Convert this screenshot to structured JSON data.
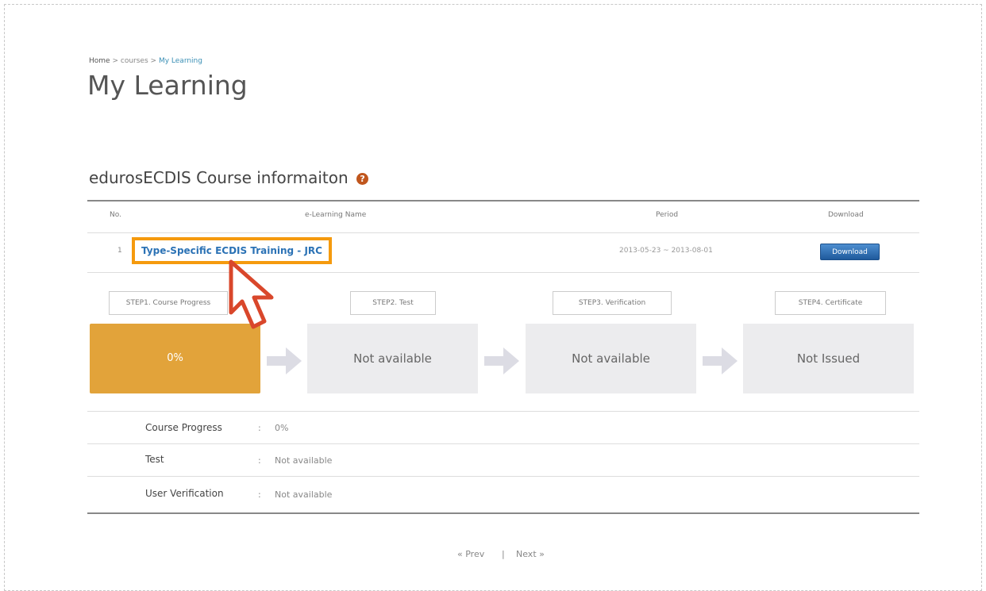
{
  "breadcrumb": {
    "home": "Home",
    "sep1": ">",
    "courses": "courses",
    "sep2": ">",
    "current": "My Learning"
  },
  "page_title": "My Learning",
  "section": {
    "title": "edurosECDIS Course informaiton",
    "help_icon": "?"
  },
  "table": {
    "headers": {
      "no": "No.",
      "name": "e-Learning Name",
      "period": "Period",
      "download": "Download"
    },
    "rows": [
      {
        "no": "1",
        "name": "Type-Specific ECDIS Training - JRC",
        "period": "2013-05-23 ~ 2013-08-01",
        "download_label": "Download"
      }
    ]
  },
  "steps": [
    {
      "label": "STEP1. Course Progress",
      "status": "0%"
    },
    {
      "label": "STEP2. Test",
      "status": "Not available"
    },
    {
      "label": "STEP3. Verification",
      "status": "Not available"
    },
    {
      "label": "STEP4. Certificate",
      "status": "Not Issued"
    }
  ],
  "details": [
    {
      "label": "Course Progress",
      "value": "0%"
    },
    {
      "label": "Test",
      "value": "Not available"
    },
    {
      "label": "User Verification",
      "value": "Not available"
    }
  ],
  "pager": {
    "prev": "« Prev",
    "sep": "|",
    "next": "Next »"
  },
  "colors": {
    "accent": "#e2a33a",
    "highlight": "#f59a0e",
    "link": "#2b72b5",
    "cursor": "#d9472b"
  }
}
